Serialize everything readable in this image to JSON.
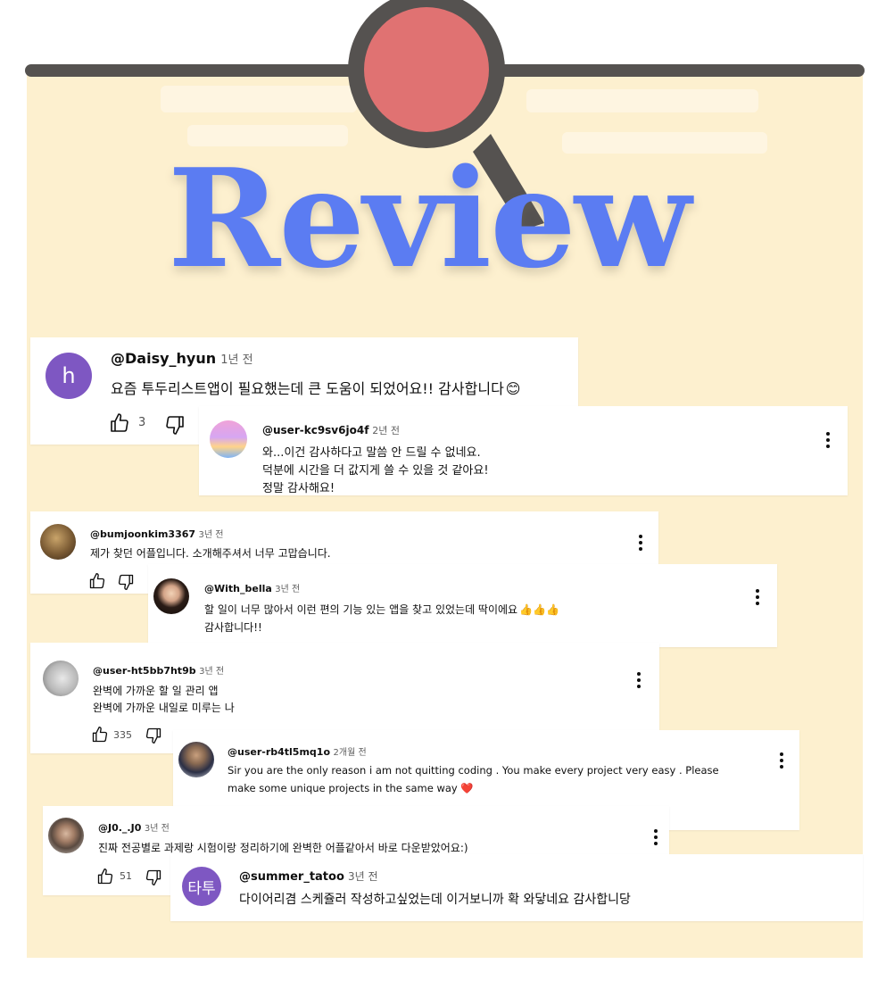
{
  "title": "Review",
  "colors": {
    "board": "#fdf0cf",
    "title": "#5b7cf2",
    "pin_head": "#e07272",
    "pin_outline": "#555250",
    "avatar_h": "#7e57c2",
    "avatar_tt": "#7e57c2"
  },
  "comments": {
    "c1": {
      "avatar_letter": "h",
      "handle": "@Daisy_hyun",
      "time": "1년 전",
      "text": "요즘 투두리스트앱이 필요했는데 큰 도움이 되었어요!! 감사합니다",
      "emoji": "😊",
      "likes": "3"
    },
    "c2": {
      "handle": "@user-kc9sv6jo4f",
      "time": "2년 전",
      "line1": "와...이건 감사하다고 말씀 안 드릴 수 없네요.",
      "line2": "덕분에 시간을 더 값지게 쓸 수 있을 것 같아요!",
      "line3": "정말 감사해요!"
    },
    "c3": {
      "handle": "@bumjoonkim3367",
      "time": "3년 전",
      "text": "제가 찾던 어플입니다. 소개해주셔서 너무 고맙습니다."
    },
    "c4": {
      "handle": "@With_bella",
      "time": "3년 전",
      "line1": "할 일이 너무 많아서 이런 편의 기능 있는 앱을 찾고 있었는데 딱이에요",
      "emoji": "👍👍👍",
      "line2": "감사합니다!!"
    },
    "c5": {
      "handle": "@user-ht5bb7ht9b",
      "time": "3년 전",
      "line1": "완벽에 가까운 할 일 관리 앱",
      "line2": "완벽에 가까운 내일로 미루는 나",
      "likes": "335"
    },
    "c6": {
      "handle": "@user-rb4tl5mq1o",
      "time": "2개월 전",
      "line1": "Sir you are the only reason i am not quitting coding . You make every project very easy . Please",
      "line2": "make some unique projects in the same way",
      "emoji": "❤️"
    },
    "c7": {
      "handle": "@J0._.J0",
      "time": "3년 전",
      "text": "진짜 전공별로 과제랑 시험이랑 정리하기에 완벽한 어플같아서 바로 다운받았어요:)",
      "likes": "51"
    },
    "c8": {
      "avatar_letter": "타투",
      "handle": "@summer_tatoo",
      "time": "3년 전",
      "text": "다이어리겸 스케쥴러 작성하고싶었는데 이거보니까 확 와닿네요 감사합니당"
    }
  },
  "icons": {
    "like": "thumbs-up-icon",
    "dislike": "thumbs-down-icon",
    "menu": "more-vertical-icon",
    "pin": "push-pin-icon"
  }
}
